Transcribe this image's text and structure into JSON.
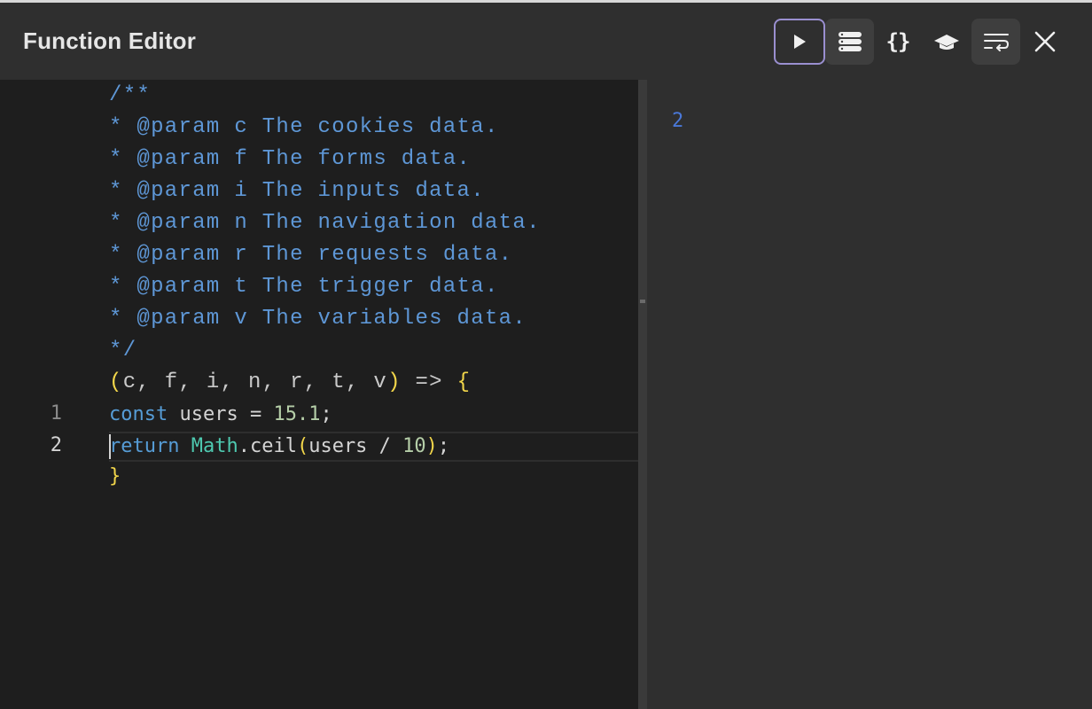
{
  "header": {
    "title": "Function Editor"
  },
  "toolbar": {
    "run_icon": "play-icon",
    "list_icon": "list-icon",
    "json_label": "{}",
    "learn_icon": "graduation-cap-icon",
    "wrap_icon": "word-wrap-icon",
    "close_icon": "close-icon"
  },
  "editor": {
    "comment": [
      "/**",
      "* @param c The cookies data.",
      "* @param f The forms data.",
      "* @param i The inputs data.",
      "* @param n The navigation data.",
      "* @param r The requests data.",
      "* @param t The trigger data.",
      "* @param v The variables data.",
      "*/"
    ],
    "signature": {
      "open_paren": "(",
      "params": "c, f, i, n, r, t, v",
      "close_paren": ")",
      "arrow": " => ",
      "open_brace": "{"
    },
    "lines": [
      {
        "number": "1",
        "kw": "const",
        "var": " users = ",
        "num": "15.1",
        "end": ";"
      },
      {
        "number": "2",
        "kw": "return",
        "cls": "Math",
        "method": ".ceil",
        "open": "(",
        "arg": "users / ",
        "num": "10",
        "close": ")",
        "end": ";"
      }
    ],
    "close_brace": "}"
  },
  "output": {
    "value": "2"
  },
  "colors": {
    "comment": "#5e97d6",
    "keyword": "#569cd6",
    "number": "#b5cea8",
    "class": "#4ec9b0",
    "brace": "#f2d64a",
    "output": "#4a78d8",
    "run_border": "#9a8fd0"
  }
}
